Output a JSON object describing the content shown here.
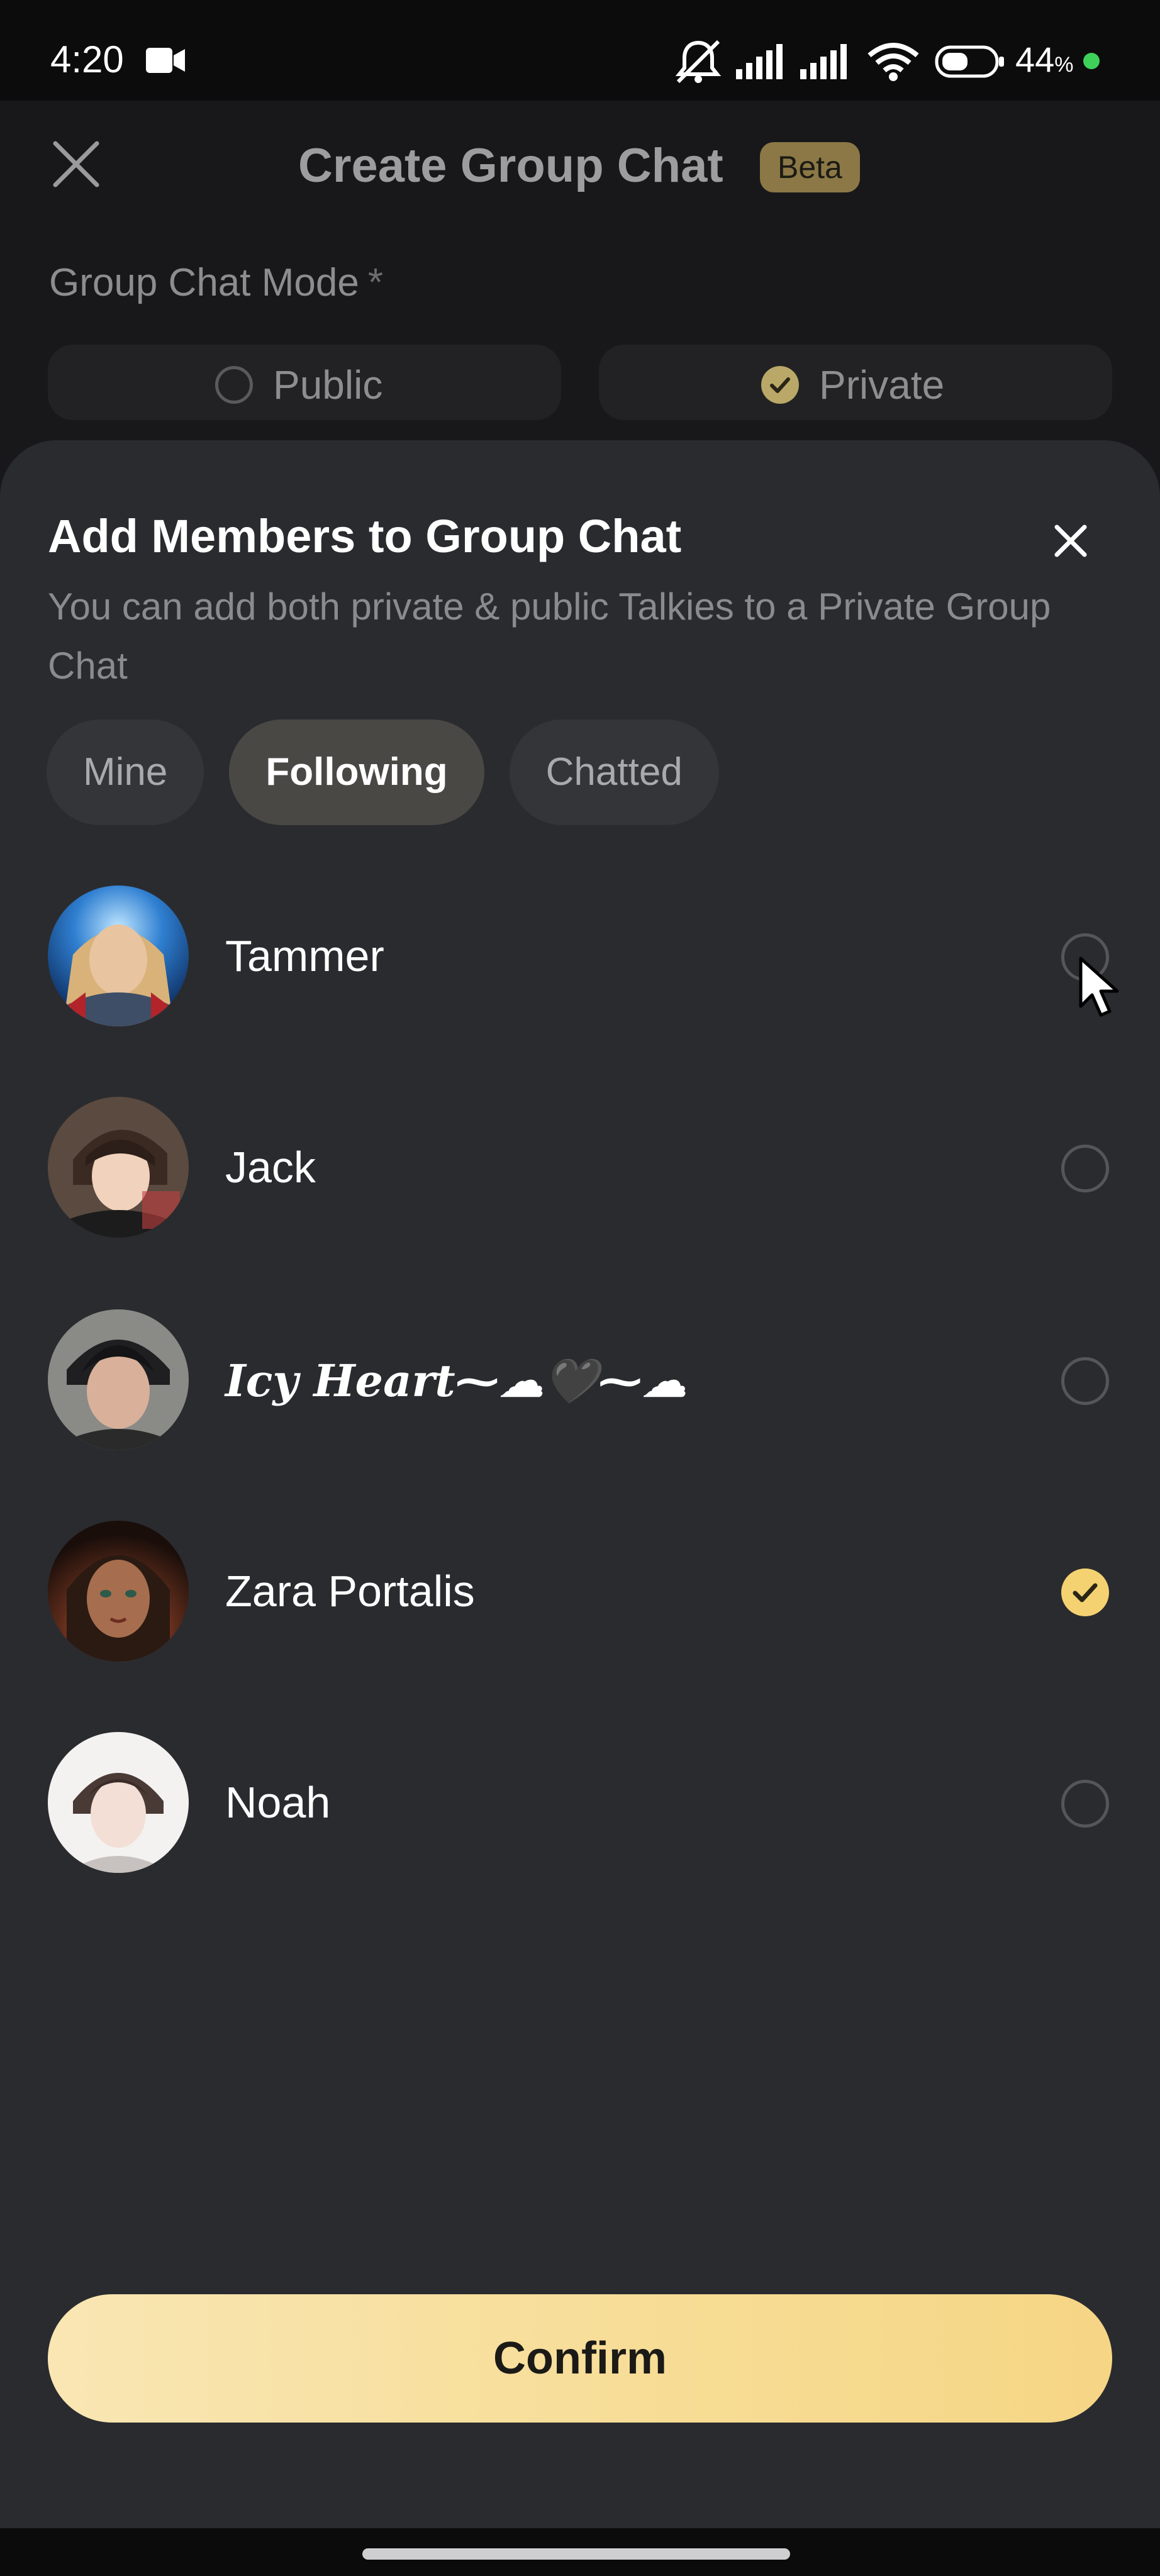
{
  "status_bar": {
    "time": "4:20",
    "battery": "44",
    "battery_unit": "%"
  },
  "background": {
    "title": "Create Group Chat",
    "badge": "Beta",
    "mode_label": "Group Chat Mode",
    "mode_required": "*",
    "mode_options": [
      {
        "label": "Public",
        "selected": false
      },
      {
        "label": "Private",
        "selected": true
      }
    ],
    "accent_color": "#b9a867"
  },
  "sheet": {
    "title": "Add Members to Group Chat",
    "subtitle": "You can add both private & public Talkies to a Private Group Chat",
    "tabs": [
      {
        "label": "Mine",
        "active": false
      },
      {
        "label": "Following",
        "active": true
      },
      {
        "label": "Chatted",
        "active": false
      }
    ],
    "members": [
      {
        "name": "Tammer",
        "selected": false,
        "avatar": "avatar-tammer"
      },
      {
        "name": "Jack",
        "selected": false,
        "avatar": "avatar-jack"
      },
      {
        "name": "Icy Heart⁓☁🖤⁓☁",
        "selected": false,
        "avatar": "avatar-icy-heart"
      },
      {
        "name": "Zara Portalis",
        "selected": true,
        "avatar": "avatar-zara"
      },
      {
        "name": "Noah",
        "selected": false,
        "avatar": "avatar-noah"
      }
    ],
    "confirm_label": "Confirm",
    "confirm_color": "#f7dd97",
    "check_color": "#f5d271"
  }
}
